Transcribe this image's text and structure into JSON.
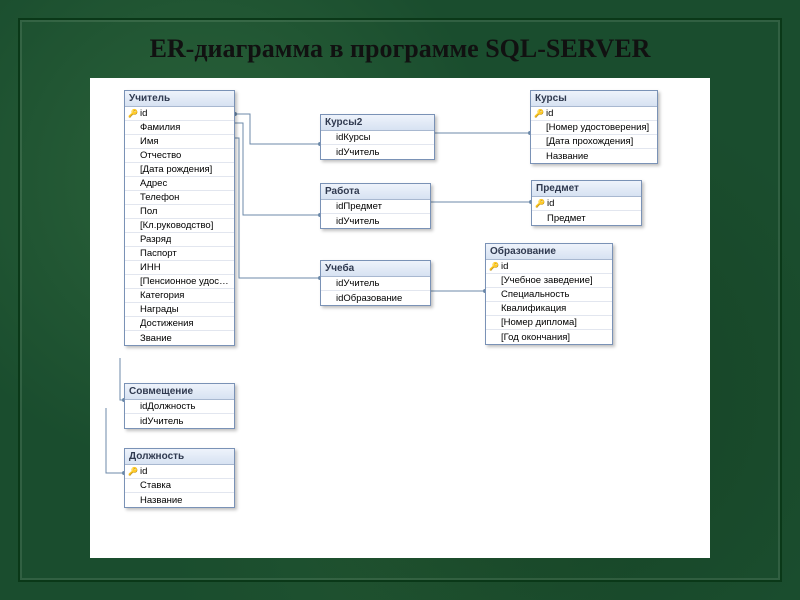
{
  "title": "ER-диаграмма в программе SQL-SERVER",
  "tables": {
    "teacher": {
      "name": "Учитель",
      "fields": [
        "id",
        "Фамилия",
        "Имя",
        "Отчество",
        "[Дата рождения]",
        "Адрес",
        "Телефон",
        "Пол",
        "[Кл.руководство]",
        "Разряд",
        "Паспорт",
        "ИНН",
        "[Пенсионное удостовер…",
        "Категория",
        "Награды",
        "Достижения",
        "Звание"
      ],
      "pk": [
        0
      ]
    },
    "sovmesh": {
      "name": "Совмещение",
      "fields": [
        "idДолжность",
        "idУчитель"
      ],
      "pk": []
    },
    "dolzhnost": {
      "name": "Должность",
      "fields": [
        "id",
        "Ставка",
        "Название"
      ],
      "pk": [
        0
      ]
    },
    "kursy2": {
      "name": "Курсы2",
      "fields": [
        "idКурсы",
        "idУчитель"
      ],
      "pk": []
    },
    "rabota": {
      "name": "Работа",
      "fields": [
        "idПредмет",
        "idУчитель"
      ],
      "pk": []
    },
    "ucheba": {
      "name": "Учеба",
      "fields": [
        "idУчитель",
        "idОбразование"
      ],
      "pk": []
    },
    "kursy": {
      "name": "Курсы",
      "fields": [
        "id",
        "[Номер удостоверения]",
        "[Дата прохождения]",
        "Название"
      ],
      "pk": [
        0
      ]
    },
    "predmet": {
      "name": "Предмет",
      "fields": [
        "id",
        "Предмет"
      ],
      "pk": [
        0
      ]
    },
    "obrazov": {
      "name": "Образование",
      "fields": [
        "id",
        "[Учебное заведение]",
        "Специальность",
        "Квалификация",
        "[Номер диплома]",
        "[Год окончания]"
      ],
      "pk": [
        0
      ]
    }
  }
}
